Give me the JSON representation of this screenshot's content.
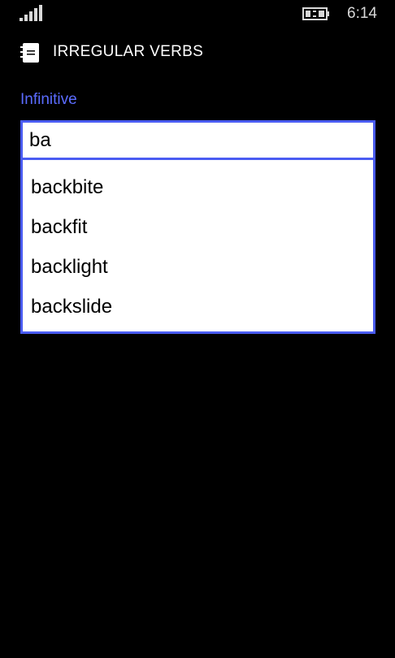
{
  "status_bar": {
    "time": "6:14",
    "signal_icon": "signal-strength-icon",
    "battery_icon": "battery-charging-icon"
  },
  "header": {
    "app_icon": "notebook-icon",
    "title": "IRREGULAR VERBS"
  },
  "main": {
    "infinitive_label": "Infinitive",
    "search": {
      "value": "ba"
    },
    "suggestions": [
      "backbite",
      "backfit",
      "backlight",
      "backslide"
    ]
  },
  "colors": {
    "accent": "#5b6cff",
    "border": "#4a5cf2",
    "background": "#000000"
  }
}
